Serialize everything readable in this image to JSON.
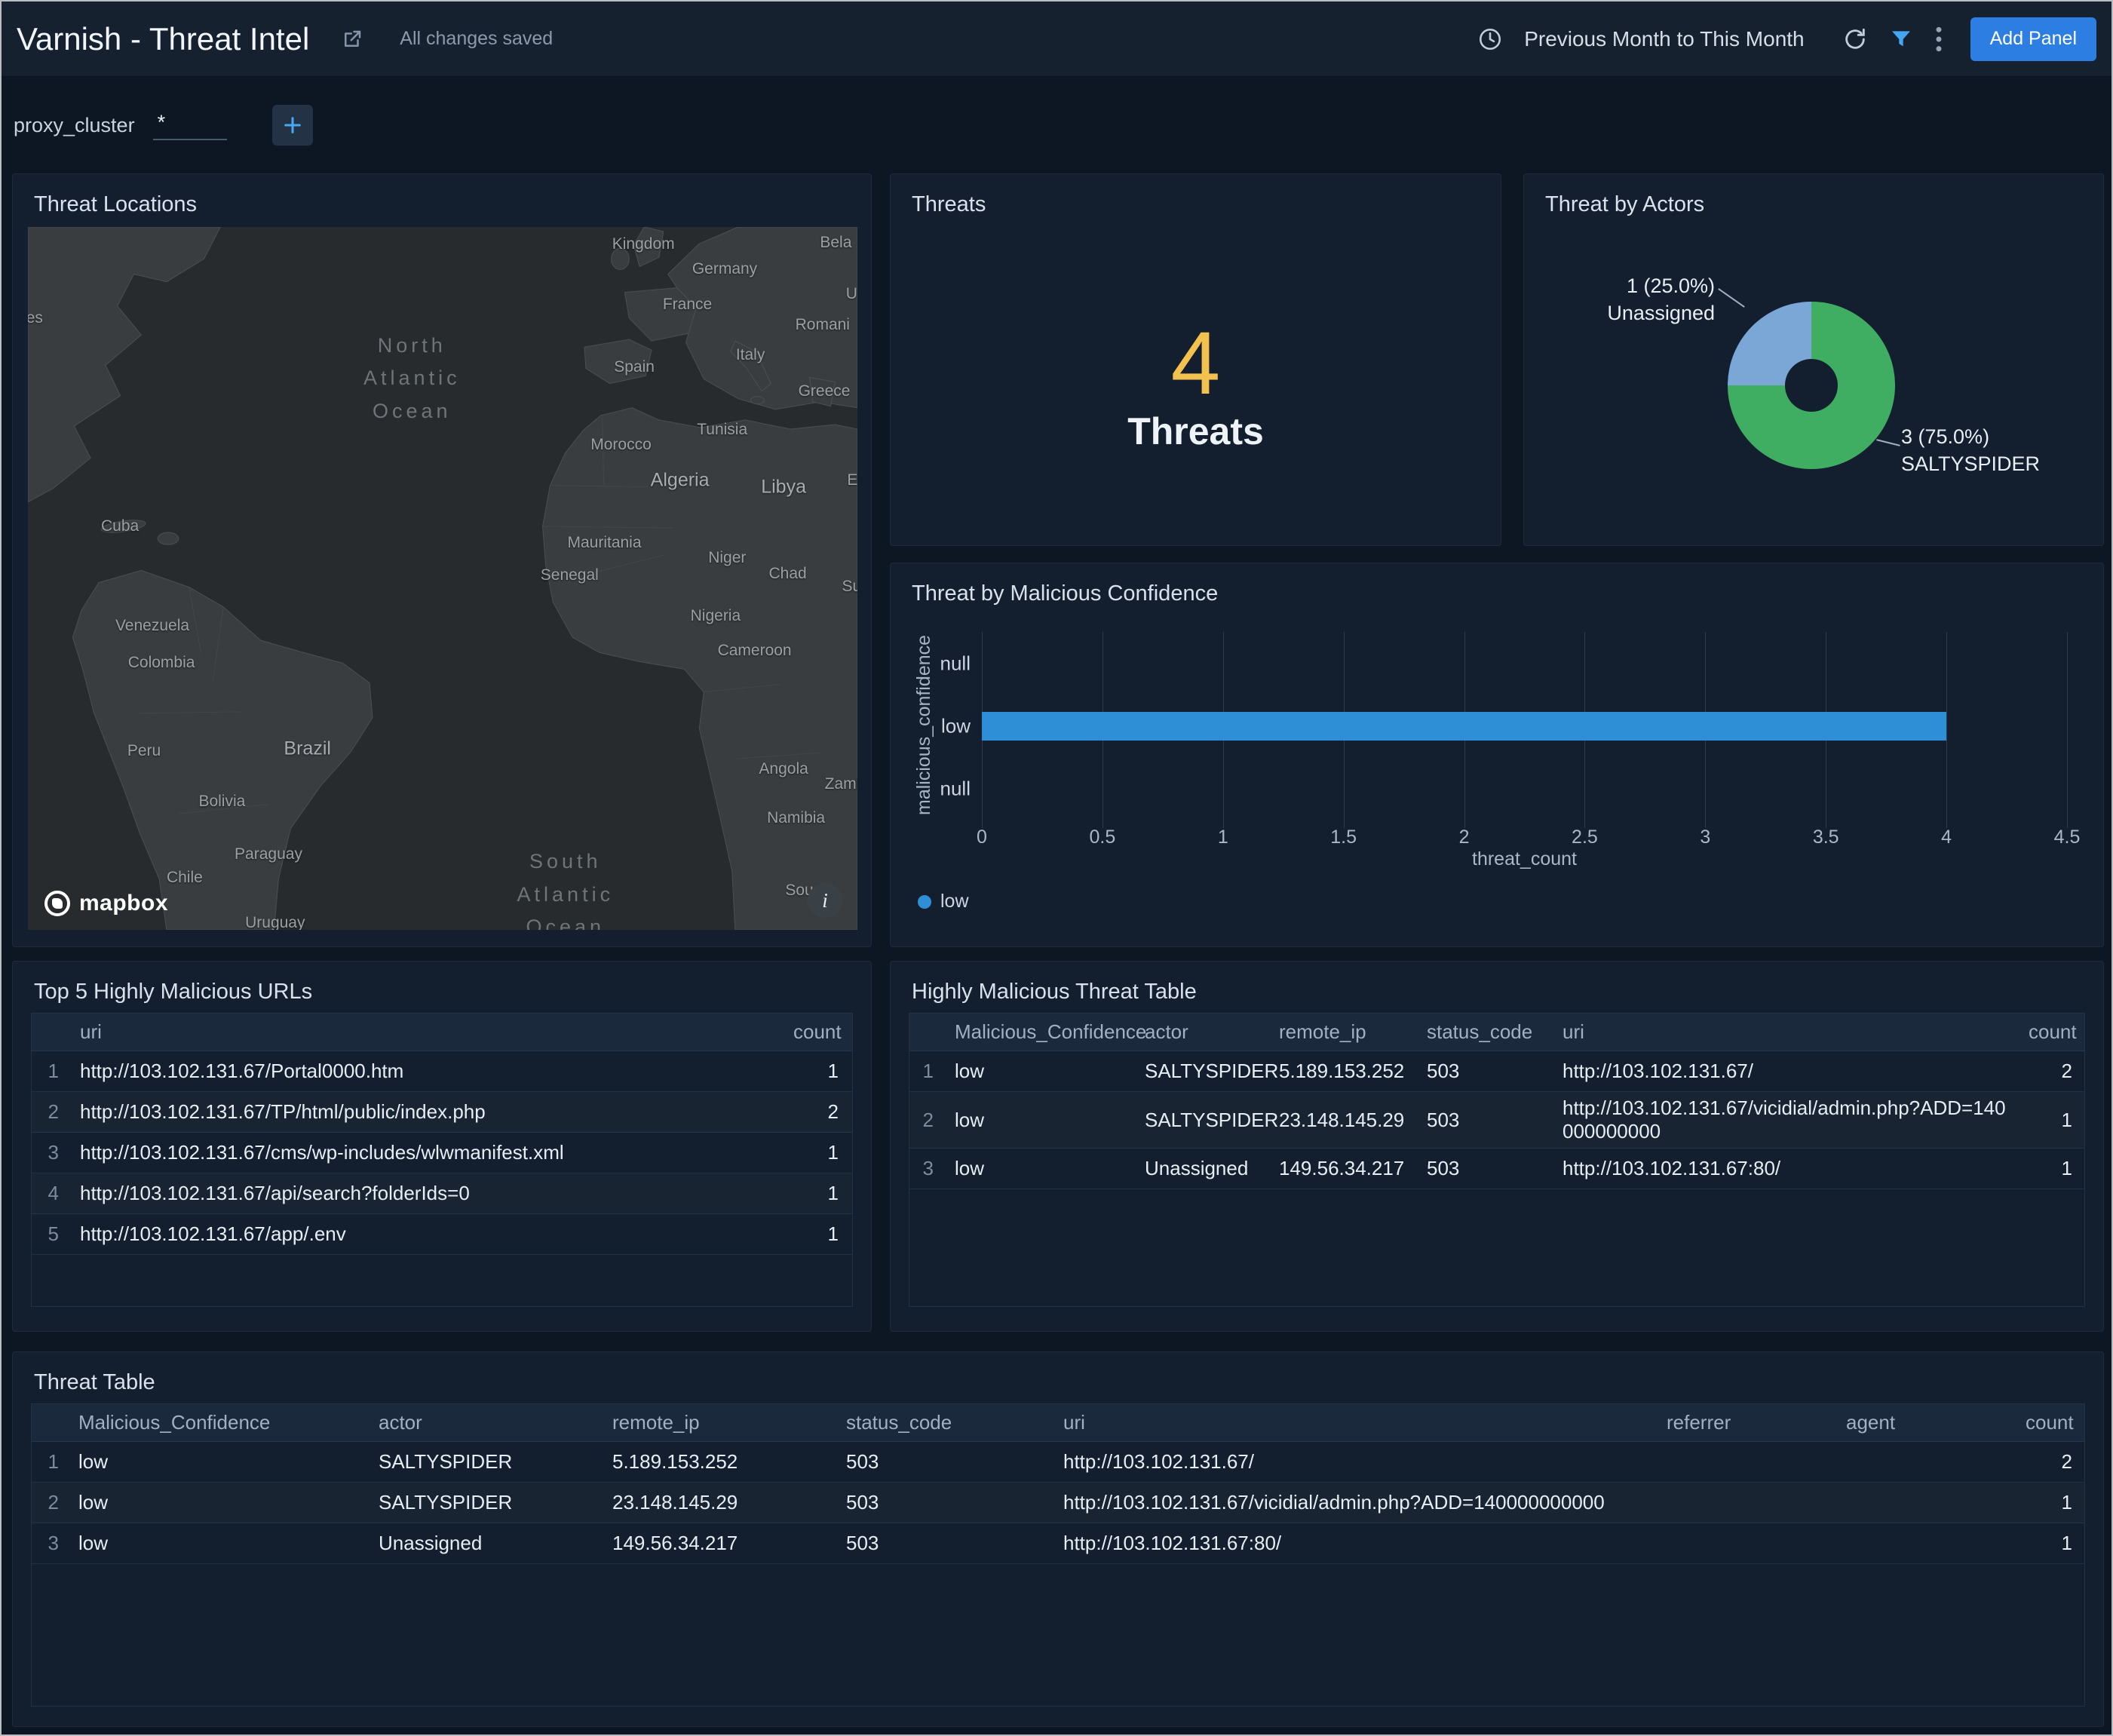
{
  "header": {
    "title": "Varnish - Threat Intel",
    "save_status": "All changes saved",
    "time_range": "Previous Month to This Month",
    "add_panel": "Add Panel"
  },
  "filter_bar": {
    "name": "proxy_cluster",
    "value": "*"
  },
  "icons": {
    "kebab_glyph": "⋮",
    "info_glyph": "i"
  },
  "map_panel": {
    "title": "Threat Locations",
    "attribution": "mapbox",
    "ocean_labels": {
      "north": "North\nAtlantic\nOcean",
      "south": "South\nAtlantic\nOcean"
    },
    "labels": [
      "Kingdom",
      "Bela",
      "Germany",
      "U",
      "France",
      "Romani",
      "Spain",
      "Italy",
      "Greece",
      "Morocco",
      "Tunisia",
      "Algeria",
      "Libya",
      "E",
      "Mauritania",
      "Senegal",
      "Niger",
      "Chad",
      "Su",
      "Nigeria",
      "Cameroon",
      "Cuba",
      "es",
      "Venezuela",
      "Colombia",
      "Peru",
      "Brazil",
      "Bolivia",
      "Paraguay",
      "Chile",
      "Uruguay",
      "Angola",
      "Zamb",
      "Namibia",
      "Sou"
    ]
  },
  "threats_panel": {
    "title": "Threats",
    "value": "4",
    "label": "Threats",
    "value_color": "#f2c14e"
  },
  "actors_panel": {
    "title": "Threat by Actors",
    "slices": [
      {
        "line1": "1 (25.0%)",
        "line2": "Unassigned",
        "value": 1,
        "color": "#7ba7d7"
      },
      {
        "line1": "3 (75.0%)",
        "line2": "SALTYSPIDER",
        "value": 3,
        "color": "#3fae62"
      }
    ]
  },
  "confidence_panel": {
    "title": "Threat by Malicious Confidence",
    "y_axis_label": "malicious_confidence",
    "x_axis_label": "threat_count",
    "categories": [
      "null",
      "low",
      "null"
    ],
    "x_ticks": [
      "0",
      "0.5",
      "1",
      "1.5",
      "2",
      "2.5",
      "3",
      "3.5",
      "4",
      "4.5"
    ],
    "x_max": 4.5,
    "bar_value": 4,
    "bar_color": "#2e8fd6",
    "legend": [
      "low"
    ]
  },
  "top5_panel": {
    "title": "Top 5 Highly Malicious URLs",
    "headers": {
      "uri": "uri",
      "count": "count"
    },
    "rows": [
      {
        "n": "1",
        "uri": "http://103.102.131.67/Portal0000.htm",
        "count": "1"
      },
      {
        "n": "2",
        "uri": "http://103.102.131.67/TP/html/public/index.php",
        "count": "2"
      },
      {
        "n": "3",
        "uri": "http://103.102.131.67/cms/wp-includes/wlwmanifest.xml",
        "count": "1"
      },
      {
        "n": "4",
        "uri": "http://103.102.131.67/api/search?folderIds=0",
        "count": "1"
      },
      {
        "n": "5",
        "uri": "http://103.102.131.67/app/.env",
        "count": "1"
      }
    ]
  },
  "hm_panel": {
    "title": "Highly Malicious Threat Table",
    "headers": {
      "confidence": "Malicious_Confidence",
      "actor": "actor",
      "remote_ip": "remote_ip",
      "status_code": "status_code",
      "uri": "uri",
      "count": "count"
    },
    "rows": [
      {
        "n": "1",
        "confidence": "low",
        "actor": "SALTYSPIDER",
        "remote_ip": "5.189.153.252",
        "status_code": "503",
        "uri": "http://103.102.131.67/",
        "count": "2"
      },
      {
        "n": "2",
        "confidence": "low",
        "actor": "SALTYSPIDER",
        "remote_ip": "23.148.145.29",
        "status_code": "503",
        "uri": "http://103.102.131.67/vicidial/admin.php?ADD=140000000000",
        "count": "1"
      },
      {
        "n": "3",
        "confidence": "low",
        "actor": "Unassigned",
        "remote_ip": "149.56.34.217",
        "status_code": "503",
        "uri": "http://103.102.131.67:80/",
        "count": "1"
      }
    ]
  },
  "threat_panel": {
    "title": "Threat Table",
    "headers": {
      "confidence": "Malicious_Confidence",
      "actor": "actor",
      "remote_ip": "remote_ip",
      "status_code": "status_code",
      "uri": "uri",
      "referrer": "referrer",
      "agent": "agent",
      "count": "count"
    },
    "rows": [
      {
        "n": "1",
        "confidence": "low",
        "actor": "SALTYSPIDER",
        "remote_ip": "5.189.153.252",
        "status_code": "503",
        "uri": "http://103.102.131.67/",
        "referrer": "",
        "agent": "",
        "count": "2"
      },
      {
        "n": "2",
        "confidence": "low",
        "actor": "SALTYSPIDER",
        "remote_ip": "23.148.145.29",
        "status_code": "503",
        "uri": "http://103.102.131.67/vicidial/admin.php?ADD=140000000000",
        "referrer": "",
        "agent": "",
        "count": "1"
      },
      {
        "n": "3",
        "confidence": "low",
        "actor": "Unassigned",
        "remote_ip": "149.56.34.217",
        "status_code": "503",
        "uri": "http://103.102.131.67:80/",
        "referrer": "",
        "agent": "",
        "count": "1"
      }
    ]
  },
  "chart_data": [
    {
      "type": "pie",
      "title": "Threat by Actors",
      "labels": [
        "SALTYSPIDER",
        "Unassigned"
      ],
      "values": [
        3,
        1
      ],
      "percents": [
        75.0,
        25.0
      ],
      "colors": [
        "#3fae62",
        "#7ba7d7"
      ],
      "donut": true
    },
    {
      "type": "bar",
      "title": "Threat by Malicious Confidence",
      "orientation": "horizontal",
      "categories": [
        "null",
        "low",
        "null"
      ],
      "values": [
        0,
        4,
        0
      ],
      "xlabel": "threat_count",
      "ylabel": "malicious_confidence",
      "xlim": [
        0,
        4.5
      ],
      "legend": [
        "low"
      ],
      "color": "#2e8fd6",
      "grid": true
    },
    {
      "type": "single_value",
      "title": "Threats",
      "value": 4
    }
  ]
}
